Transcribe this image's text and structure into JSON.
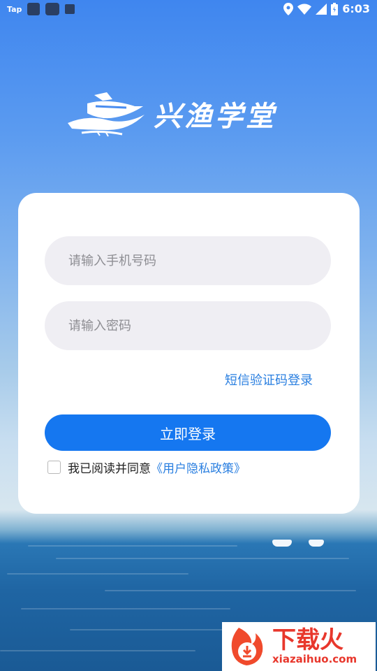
{
  "status_bar": {
    "app_label": "Tap",
    "time": "6:03"
  },
  "logo": {
    "text": "兴渔学堂"
  },
  "login": {
    "phone_placeholder": "请输入手机号码",
    "password_placeholder": "请输入密码",
    "sms_login_link": "短信验证码登录",
    "login_button": "立即登录",
    "agreement_prefix": "我已阅读并同意",
    "policy_link": "《用户隐私政策》"
  },
  "watermark": {
    "brand": "下载火",
    "url": "xiazaihuo.com"
  },
  "colors": {
    "primary_button": "#1577f0",
    "link": "#2a7fe0",
    "input_background": "#efeef3"
  }
}
